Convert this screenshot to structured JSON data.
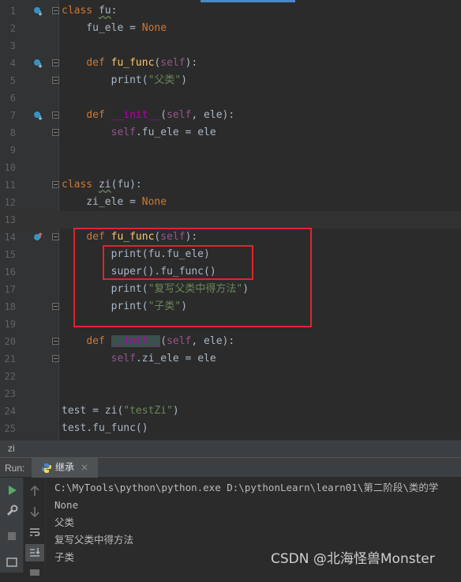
{
  "editor": {
    "line_numbers": [
      "1",
      "2",
      "3",
      "4",
      "5",
      "6",
      "7",
      "8",
      "9",
      "10",
      "11",
      "12",
      "13",
      "14",
      "15",
      "16",
      "17",
      "18",
      "19",
      "20",
      "21",
      "22",
      "23",
      "24",
      "25"
    ],
    "lines": {
      "l1": {
        "kw": "class",
        "name": "fu",
        "punct": ":"
      },
      "l2": {
        "text": "    fu_ele = ",
        "kw": "None"
      },
      "l4": {
        "indent": "    ",
        "kw": "def",
        "fn": "fu_func",
        "open": "(",
        "self": "self",
        "close": "):"
      },
      "l5": {
        "indent": "        ",
        "call": "print(",
        "str": "\"父类\"",
        "close": ")"
      },
      "l7": {
        "indent": "    ",
        "kw": "def",
        "fn": "__init__",
        "open": "(",
        "self": "self",
        "rest": ", ele):"
      },
      "l8": {
        "indent": "        ",
        "self": "self",
        "rest": ".fu_ele = ele"
      },
      "l11": {
        "kw": "class",
        "name": "zi",
        "rest": "(fu):"
      },
      "l12": {
        "text": "    zi_ele = ",
        "kw": "None"
      },
      "l14": {
        "indent": "    ",
        "kw": "def",
        "fn": "fu_func",
        "open": "(",
        "self": "self",
        "close": "):"
      },
      "l15": {
        "text": "        print(fu.fu_ele)"
      },
      "l16": {
        "text": "        super().fu_func()"
      },
      "l17": {
        "indent": "        ",
        "call": "print(",
        "str": "\"复写父类中得方法\"",
        "close": ")"
      },
      "l18": {
        "indent": "        ",
        "call": "print(",
        "str": "\"子类\"",
        "close": ")"
      },
      "l20": {
        "indent": "    ",
        "kw": "def",
        "fn": "__init__",
        "open": "(",
        "self": "self",
        "rest": ", ele):"
      },
      "l21": {
        "indent": "        ",
        "self": "self",
        "rest": ".zi_ele = ele"
      },
      "l24": {
        "text": "test = zi(",
        "str": "\"testZi\"",
        "close": ")"
      },
      "l25": {
        "text": "test.fu_func()"
      }
    }
  },
  "breadcrumb": {
    "label": "zi"
  },
  "run": {
    "label": "Run:",
    "tab_label": "继承",
    "tab_close": "×"
  },
  "console": {
    "lines": [
      "C:\\MyTools\\python\\python.exe D:\\pythonLearn\\learn01\\第二阶段\\类的学",
      "None",
      "父类",
      "复写父类中得方法",
      "子类"
    ]
  },
  "watermark": {
    "text": "CSDN @北海怪兽Monster"
  },
  "colors": {
    "background": "#2b2b2b",
    "keyword": "#cc7832",
    "function": "#ffc66d",
    "string": "#6a8759",
    "self": "#94558d",
    "highlight_box": "#e0242e",
    "run_icon": "#59a869"
  }
}
